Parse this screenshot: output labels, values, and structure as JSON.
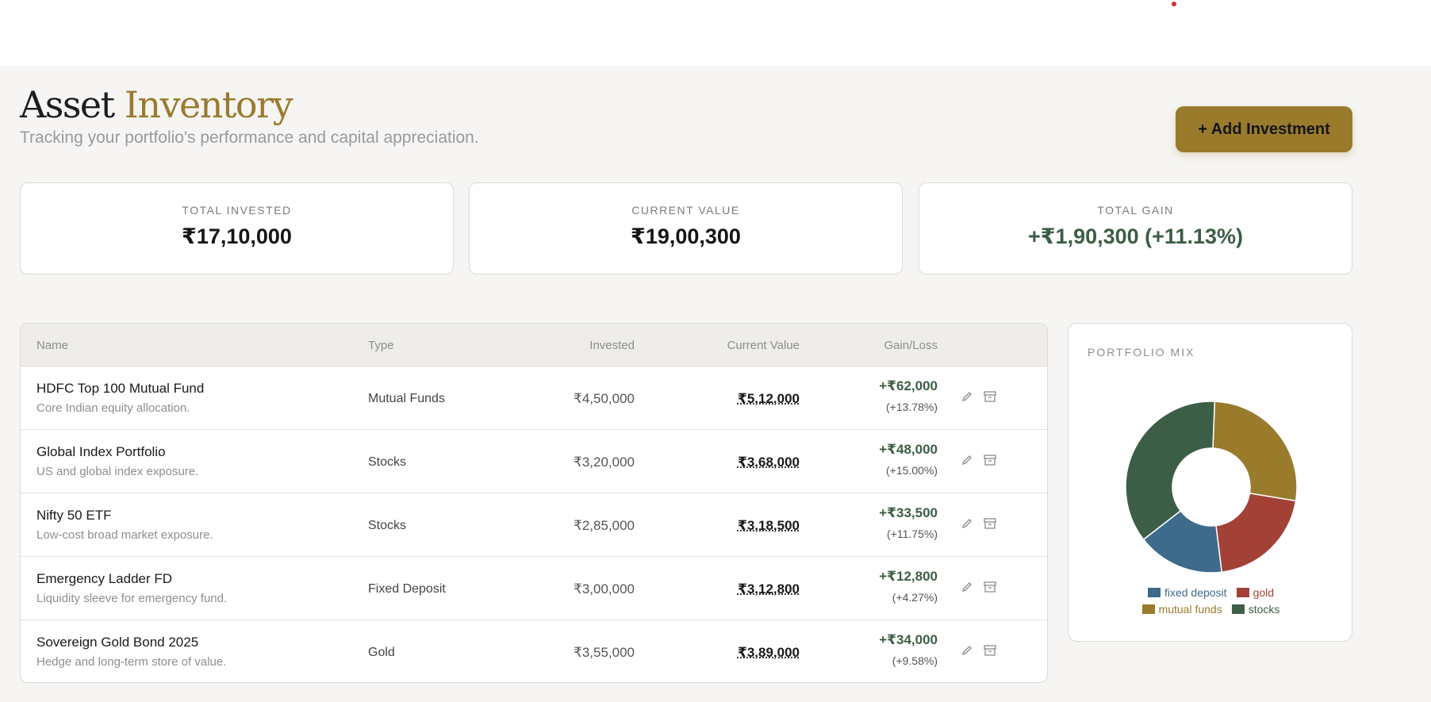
{
  "header": {
    "title_main": "Asset",
    "title_accent": "Inventory",
    "subtitle": "Tracking your portfolio's performance and capital appreciation.",
    "add_button": "+ Add Investment"
  },
  "summary": [
    {
      "label": "TOTAL INVESTED",
      "value": "₹17,10,000"
    },
    {
      "label": "CURRENT VALUE",
      "value": "₹19,00,300"
    },
    {
      "label": "TOTAL GAIN",
      "value": "+₹1,90,300 (+11.13%)"
    }
  ],
  "table": {
    "headers": {
      "name": "Name",
      "type": "Type",
      "invested": "Invested",
      "current": "Current Value",
      "gain": "Gain/Loss"
    },
    "rows": [
      {
        "name": "HDFC Top 100 Mutual Fund",
        "note": "Core Indian equity allocation.",
        "type": "Mutual Funds",
        "invested": "₹4,50,000",
        "current": "₹5,12,000",
        "gain": "+₹62,000",
        "pct": "(+13.78%)"
      },
      {
        "name": "Global Index Portfolio",
        "note": "US and global index exposure.",
        "type": "Stocks",
        "invested": "₹3,20,000",
        "current": "₹3,68,000",
        "gain": "+₹48,000",
        "pct": "(+15.00%)"
      },
      {
        "name": "Nifty 50 ETF",
        "note": "Low-cost broad market exposure.",
        "type": "Stocks",
        "invested": "₹2,85,000",
        "current": "₹3,18,500",
        "gain": "+₹33,500",
        "pct": "(+11.75%)"
      },
      {
        "name": "Emergency Ladder FD",
        "note": "Liquidity sleeve for emergency fund.",
        "type": "Fixed Deposit",
        "invested": "₹3,00,000",
        "current": "₹3,12,800",
        "gain": "+₹12,800",
        "pct": "(+4.27%)"
      },
      {
        "name": "Sovereign Gold Bond 2025",
        "note": "Hedge and long-term store of value.",
        "type": "Gold",
        "invested": "₹3,55,000",
        "current": "₹3,89,000",
        "gain": "+₹34,000",
        "pct": "(+9.58%)"
      }
    ],
    "row_icons": [
      "pencil-icon",
      "archive-icon"
    ]
  },
  "portfolio_mix": {
    "label": "PORTFOLIO MIX",
    "chart_data": {
      "type": "pie",
      "categories": [
        "mutual funds",
        "gold",
        "fixed deposit",
        "stocks"
      ],
      "values": [
        512000,
        389000,
        312800,
        686500
      ],
      "colors": [
        "#9a7b2c",
        "#a34136",
        "#3e6a8c",
        "#3c5e46"
      ],
      "legend_position": "bottom"
    },
    "legend": [
      {
        "label": "fixed deposit",
        "color": "#3e6a8c"
      },
      {
        "label": "gold",
        "color": "#a34136"
      },
      {
        "label": "mutual funds",
        "color": "#9a7b2c"
      },
      {
        "label": "stocks",
        "color": "#3c5e46"
      }
    ]
  }
}
